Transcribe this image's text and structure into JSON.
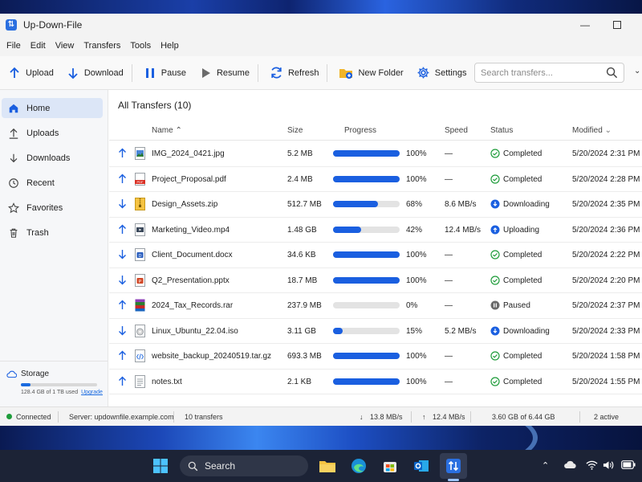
{
  "window": {
    "title": "Up-Down-File"
  },
  "menu": [
    "File",
    "Edit",
    "View",
    "Transfers",
    "Tools",
    "Help"
  ],
  "toolbar": {
    "upload": "Upload",
    "download": "Download",
    "pause": "Pause",
    "resume": "Resume",
    "refresh": "Refresh",
    "new_folder": "New Folder",
    "settings": "Settings",
    "search_placeholder": "Search transfers..."
  },
  "sidebar": {
    "items": [
      {
        "label": "Home",
        "icon": "home-icon",
        "active": true
      },
      {
        "label": "Uploads",
        "icon": "upload-icon"
      },
      {
        "label": "Downloads",
        "icon": "download-icon"
      },
      {
        "label": "Recent",
        "icon": "clock-icon"
      },
      {
        "label": "Favorites",
        "icon": "star-icon"
      },
      {
        "label": "Trash",
        "icon": "trash-icon"
      }
    ],
    "storage": {
      "title": "Storage",
      "used_text": "128.4 GB of 1 TB used",
      "upgrade": "Upgrade",
      "used_fraction": 0.1254
    }
  },
  "content": {
    "title": "All Transfers (10)",
    "columns": {
      "name": "Name",
      "size": "Size",
      "progress": "Progress",
      "speed": "Speed",
      "status": "Status",
      "modified": "Modified"
    },
    "rows": [
      {
        "dir": "up",
        "type": "image",
        "name": "IMG_2024_0421.jpg",
        "size": "5.2 MB",
        "progress": 100,
        "pct": "100%",
        "speed": "—",
        "status": "Completed",
        "status_kind": "completed",
        "modified": "5/20/2024 2:31 PM"
      },
      {
        "dir": "up",
        "type": "pdf",
        "name": "Project_Proposal.pdf",
        "size": "2.4 MB",
        "progress": 100,
        "pct": "100%",
        "speed": "—",
        "status": "Completed",
        "status_kind": "completed",
        "modified": "5/20/2024 2:28 PM"
      },
      {
        "dir": "down",
        "type": "zip",
        "name": "Design_Assets.zip",
        "size": "512.7 MB",
        "progress": 68,
        "pct": "68%",
        "speed": "8.6 MB/s",
        "status": "Downloading",
        "status_kind": "downloading",
        "modified": "5/20/2024 2:35 PM"
      },
      {
        "dir": "up",
        "type": "video",
        "name": "Marketing_Video.mp4",
        "size": "1.48 GB",
        "progress": 42,
        "pct": "42%",
        "speed": "12.4 MB/s",
        "status": "Uploading",
        "status_kind": "uploading",
        "modified": "5/20/2024 2:36 PM"
      },
      {
        "dir": "down",
        "type": "doc",
        "name": "Client_Document.docx",
        "size": "34.6 KB",
        "progress": 100,
        "pct": "100%",
        "speed": "—",
        "status": "Completed",
        "status_kind": "completed",
        "modified": "5/20/2024 2:22 PM"
      },
      {
        "dir": "down",
        "type": "ppt",
        "name": "Q2_Presentation.pptx",
        "size": "18.7 MB",
        "progress": 100,
        "pct": "100%",
        "speed": "—",
        "status": "Completed",
        "status_kind": "completed",
        "modified": "5/20/2024 2:20 PM"
      },
      {
        "dir": "up",
        "type": "rar",
        "name": "2024_Tax_Records.rar",
        "size": "237.9 MB",
        "progress": 0,
        "pct": "0%",
        "speed": "—",
        "status": "Paused",
        "status_kind": "paused",
        "modified": "5/20/2024 2:37 PM"
      },
      {
        "dir": "down",
        "type": "iso",
        "name": "Linux_Ubuntu_22.04.iso",
        "size": "3.11 GB",
        "progress": 15,
        "pct": "15%",
        "speed": "5.2 MB/s",
        "status": "Downloading",
        "status_kind": "downloading",
        "modified": "5/20/2024 2:33 PM"
      },
      {
        "dir": "up",
        "type": "code",
        "name": "website_backup_20240519.tar.gz",
        "size": "693.3 MB",
        "progress": 100,
        "pct": "100%",
        "speed": "—",
        "status": "Completed",
        "status_kind": "completed",
        "modified": "5/20/2024 1:58 PM"
      },
      {
        "dir": "up",
        "type": "text",
        "name": "notes.txt",
        "size": "2.1 KB",
        "progress": 100,
        "pct": "100%",
        "speed": "—",
        "status": "Completed",
        "status_kind": "completed",
        "modified": "5/20/2024 1:55 PM"
      }
    ]
  },
  "statusbar": {
    "connection": "Connected",
    "server": "Server: updownfile.example.com",
    "transfers": "10 transfers",
    "down_speed": "13.8 MB/s",
    "up_speed": "12.4 MB/s",
    "total": "3.60 GB of 6.44 GB",
    "active": "2 active"
  },
  "taskbar": {
    "search": "Search"
  },
  "colors": {
    "accent": "#1a5fe0",
    "completed": "#1e9c3a",
    "active_nav": "#dce6f7"
  }
}
